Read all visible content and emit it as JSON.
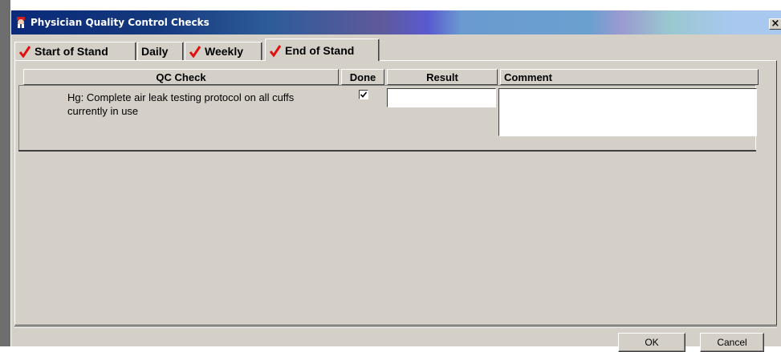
{
  "window": {
    "title": "Physician Quality Control Checks",
    "close_glyph": "×"
  },
  "tabs": [
    {
      "label": "Start of Stand",
      "checked": true
    },
    {
      "label": "Daily",
      "checked": false
    },
    {
      "label": "Weekly",
      "checked": true
    },
    {
      "label": "End of Stand",
      "checked": true,
      "active": true
    }
  ],
  "table": {
    "headers": {
      "qc_check": "QC Check",
      "done": "Done",
      "result": "Result",
      "comment": "Comment"
    },
    "rows": [
      {
        "qc_check": "Hg:  Complete air leak testing protocol on all cuffs currently in use",
        "done": true,
        "result": "",
        "comment": ""
      }
    ]
  },
  "buttons": {
    "ok": "OK",
    "cancel": "Cancel"
  },
  "colors": {
    "check_mark": "#e01010",
    "dialog_bg": "#d4d0c8",
    "title_text": "#ffffff"
  },
  "icons": {
    "app": "physician-icon",
    "tab_check": "red-check-icon",
    "close": "close-icon"
  }
}
